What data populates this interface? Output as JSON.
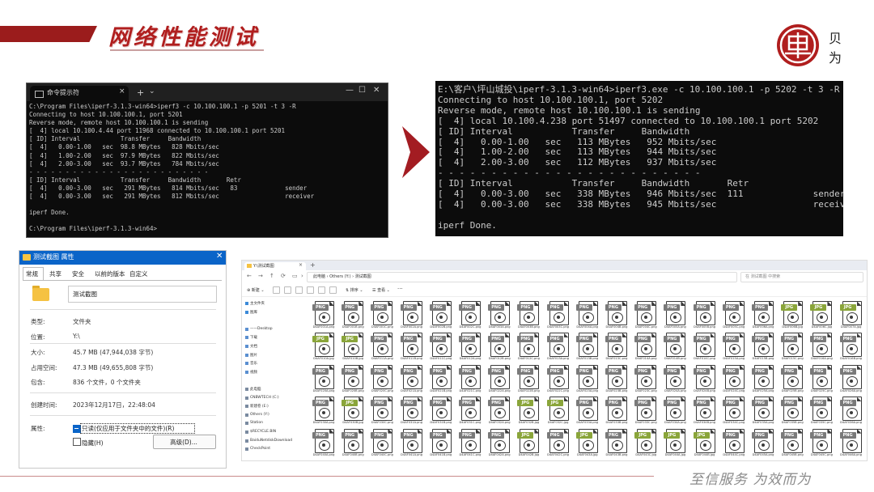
{
  "header": {
    "title": "网络性能测试"
  },
  "logo": {
    "char1": "贝",
    "char2": "为"
  },
  "terminal_left": {
    "tab_title": "命令提示符",
    "tab_close": "×",
    "new_tab": "+",
    "dropdown": "⌄",
    "win_min": "—",
    "win_max": "☐",
    "win_close": "✕",
    "text": "C:\\Program Files\\iperf-3.1.3-win64>iperf3 -c 10.100.100.1 -p 5201 -t 3 -R\nConnecting to host 10.100.100.1, port 5201\nReverse mode, remote host 10.100.100.1 is sending\n[  4] local 10.100.4.44 port 11968 connected to 10.100.100.1 port 5201\n[ ID] Interval           Transfer     Bandwidth\n[  4]   0.00-1.00   sec  98.8 MBytes   828 Mbits/sec\n[  4]   1.00-2.00   sec  97.9 MBytes   822 Mbits/sec\n[  4]   2.00-3.00   sec  93.7 MBytes   784 Mbits/sec\n- - - - - - - - - - - - - - - - - - - - - - - - -\n[ ID] Interval           Transfer     Bandwidth       Retr\n[  4]   0.00-3.00   sec   291 MBytes   814 Mbits/sec   83             sender\n[  4]   0.00-3.00   sec   291 MBytes   812 Mbits/sec                  receiver\n\niperf Done.\n\nC:\\Program Files\\iperf-3.1.3-win64>"
  },
  "terminal_right": {
    "text": "E:\\客户\\坪山城投\\iperf-3.1.3-win64>iperf3.exe -c 10.100.100.1 -p 5202 -t 3 -R\nConnecting to host 10.100.100.1, port 5202\nReverse mode, remote host 10.100.100.1 is sending\n[  4] local 10.100.4.238 port 51497 connected to 10.100.100.1 port 5202\n[ ID] Interval           Transfer     Bandwidth\n[  4]   0.00-1.00   sec   113 MBytes   952 Mbits/sec\n[  4]   1.00-2.00   sec   113 MBytes   944 Mbits/sec\n[  4]   2.00-3.00   sec   112 MBytes   937 Mbits/sec\n- - - - - - - - - - - - - - - - - - - - - - - - -\n[ ID] Interval           Transfer     Bandwidth       Retr\n[  4]   0.00-3.00   sec   338 MBytes   946 Mbits/sec  111             sender\n[  4]   0.00-3.00   sec   338 MBytes   945 Mbits/sec                  receiver\n\niperf Done."
  },
  "properties": {
    "title": "测试截图 属性",
    "close": "✕",
    "tabs": [
      "常规",
      "共享",
      "安全",
      "以前的版本",
      "自定义"
    ],
    "name": "测试截图",
    "rows": [
      {
        "label": "类型:",
        "value": "文件夹"
      },
      {
        "label": "位置:",
        "value": "Y:\\"
      },
      {
        "label": "大小:",
        "value": "45.7 MB (47,944,038 字节)"
      },
      {
        "label": "占用空间:",
        "value": "47.3 MB (49,655,808 字节)"
      },
      {
        "label": "包含:",
        "value": "836 个文件，0 个文件夹"
      },
      {
        "label": "创建时间:",
        "value": "2023年12月17日，22:48:04"
      }
    ],
    "attributes_label": "属性:",
    "readonly_label": "只读(仅应用于文件夹中的文件)(R)",
    "hidden_label": "隐藏(H)",
    "advanced_button": "高级(D)..."
  },
  "explorer": {
    "tab_title": "Y:\\测试截图",
    "tab_close": "×",
    "new_tab": "+",
    "nav": {
      "back": "←",
      "forward": "→",
      "up": "↑",
      "refresh": "⟳",
      "display": "▭",
      "next": "›"
    },
    "address": "此电脑 › Others (Y:) › 测试截图",
    "search_placeholder": "在 测试截图 中搜索",
    "cmd_new": "⊕ 新建 ⌄",
    "cmd_sort": "⇅ 排序 ⌄",
    "cmd_view": "☰ 查看 ⌄",
    "cmd_more": "···",
    "sidebar": [
      "主文件夹",
      "图库",
      "",
      "——Desktop",
      "下载",
      "文档",
      "图片",
      "音乐",
      "视频",
      "",
      "此电脑",
      "CNBWTECH (C:)",
      "新建卷 (E:)",
      "Others (Y:)",
      "Station",
      "$RECYCLE.BIN",
      "BaiduNetdiskDownload",
      "CheckPoint"
    ],
    "files": {
      "rows": [
        {
          "badges": [
            "PNG",
            "PNG",
            "PNG",
            "PNG",
            "PNG",
            "PNG",
            "PNG",
            "PNG",
            "PNG",
            "PNG",
            "PNG",
            "PNG",
            "PNG",
            "PNG",
            "PNG",
            "PNG",
            "JPG",
            "JPG",
            "JPG",
            "JPG"
          ],
          "names": [
            "D4AF001A.png",
            "D4AF001B.png",
            "D4AF001C.png",
            "D4AF002A.png",
            "D4AF002B.png",
            "D4AF002C.png",
            "D4AF003A.png",
            "D4AF003B.png",
            "D4AF003C.png",
            "D4AF004A.png",
            "D4AF004B.png",
            "D4AF004C.png",
            "D4AF005A.png",
            "D4AF005B.png",
            "D4AF005C.png",
            "D4AF006A.png",
            "D4AF006B.jpg",
            "D4AF006C.jpg",
            "D4AF007A.jpg",
            "D4AF007B.jpg"
          ]
        },
        {
          "badges": [
            "JPG",
            "JPG",
            "PNG",
            "PNG",
            "PNG",
            "PNG",
            "PNG",
            "PNG",
            "PNG",
            "PNG",
            "PNG",
            "PNG",
            "PNG",
            "PNG",
            "PNG",
            "PNG",
            "PNG",
            "PNG",
            "PNG",
            "PNG"
          ],
          "names": [
            "D4AF010A.jpg",
            "D4AF010B.jpg",
            "D4AF011A.png",
            "D4AF011B.png",
            "D4AF011C.png",
            "D4AF012A.png",
            "D4AF012B.png",
            "D4AF012C.png",
            "D4AF013A.png",
            "D4AF013B.png",
            "D4AF013C.png",
            "D4AF014A.png",
            "D4AF014B.png",
            "D4AF014C.png",
            "D4AF015A.png",
            "D4AF015B.png",
            "D4AF015C.png",
            "D4AF016A.png",
            "D4AF016B.png",
            "D4AF016C.png"
          ]
        },
        {
          "badges": [
            "PNG",
            "PNG",
            "PNG",
            "PNG",
            "PNG",
            "PNG",
            "PNG",
            "PNG",
            "PNG",
            "PNG",
            "PNG",
            "PNG",
            "PNG",
            "PNG",
            "PNG",
            "PNG",
            "PNG",
            "PNG",
            "PNG",
            "JPG"
          ],
          "names": [
            "D4AF020A.png",
            "D4AF020B.png",
            "D4AF020C.png",
            "D4AF021A.png",
            "D4AF021B.png",
            "D4AF021C.png",
            "D4AF022A.png",
            "D4AF022B.png",
            "D4AF022C.png",
            "D4AF023A.png",
            "D4AF023B.png",
            "D4AF023C.png",
            "D4AF024A.png",
            "D4AF024B.png",
            "D4AF024C.png",
            "D4AF025A.png",
            "D4AF025B.png",
            "D4AF025C.png",
            "D4AF026A.png",
            "D4AF026B.jpg"
          ]
        },
        {
          "badges": [
            "PNG",
            "JPG",
            "PNG",
            "PNG",
            "PNG",
            "PNG",
            "PNG",
            "JPG",
            "JPG",
            "PNG",
            "PNG",
            "PNG",
            "PNG",
            "PNG",
            "PNG",
            "PNG",
            "PNG",
            "PNG",
            "PNG",
            "PNG"
          ],
          "names": [
            "D4AF030A.png",
            "D4AF030B.jpg",
            "D4AF030C.png",
            "D4AF031A.png",
            "D4AF031B.png",
            "D4AF031C.png",
            "D4AF032A.png",
            "D4AF032B.jpg",
            "D4AF032C.jpg",
            "D4AF033A.png",
            "D4AF033B.png",
            "D4AF033C.png",
            "D4AF034A.png",
            "D4AF034B.png",
            "D4AF034C.png",
            "D4AF035A.png",
            "D4AF035B.png",
            "D4AF035C.png",
            "D4AF036A.png",
            "D4AF036B.png"
          ]
        },
        {
          "badges": [
            "PNG",
            "PNG",
            "PNG",
            "PNG",
            "PNG",
            "PNG",
            "PNG",
            "JPG",
            "PNG",
            "JPG",
            "PNG",
            "JPG",
            "JPG",
            "JPG",
            "PNG",
            "PNG",
            "PNG",
            "PNG",
            "PNG",
            "PNG"
          ],
          "names": [
            "D4AF040A.png",
            "D4AF040B.png",
            "D4AF040C.png",
            "D4AF041A.png",
            "D4AF041B.png",
            "D4AF041C.png",
            "D4AF042A.png",
            "D4AF042B.jpg",
            "D4AF042C.png",
            "D4AF043A.jpg",
            "D4AF043B.png",
            "D4AF043C.jpg",
            "D4AF044A.jpg",
            "D4AF044B.jpg",
            "D4AF044C.png",
            "D4AF045A.png",
            "D4AF045B.png",
            "D4AF045C.png",
            "D4AF046A.png",
            "D4AF046B.png"
          ]
        }
      ]
    }
  },
  "footer": {
    "slogan": "至信服务  为效而为"
  },
  "colors": {
    "accent": "#b01e1e",
    "png_badge": "#7a7a7a",
    "jpg_badge": "#8aa53a",
    "arrow": "#a31c22"
  }
}
